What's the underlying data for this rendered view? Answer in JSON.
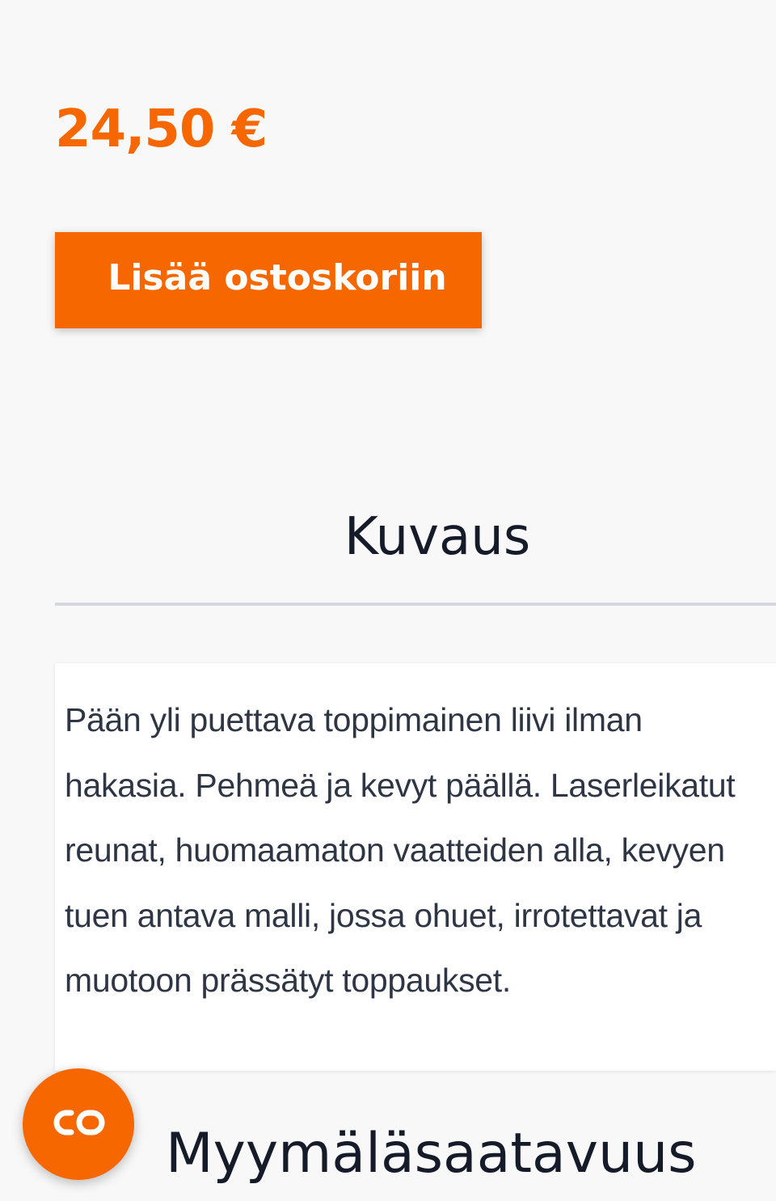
{
  "product": {
    "price": "24,50 €",
    "add_to_cart_label": "Lisää ostoskoriin"
  },
  "description": {
    "tab_title": "Kuvaus",
    "text": "Pään yli puettava toppimainen liivi ilman hakasia. Pehmeä ja kevyt päällä. Laserleikatut reunat, huomaamaton vaatteiden alla, kevyen tuen antava malli, jossa ohuet, irrotettavat ja muotoon prässätyt toppaukset."
  },
  "availability": {
    "title": "Myymäläsaatavuus"
  },
  "chat": {
    "icon": "chat-link-icon"
  },
  "colors": {
    "accent": "#f76700",
    "heading": "#151b28",
    "body_text": "#2e3645",
    "divider": "#d3d8df",
    "background": "#f8f8f8"
  }
}
